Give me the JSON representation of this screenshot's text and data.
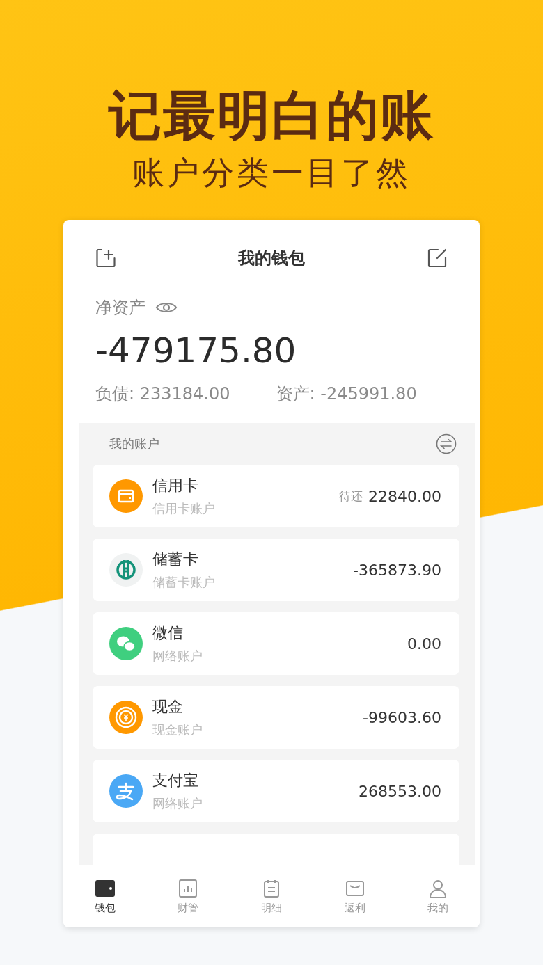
{
  "headline": "记最明白的账",
  "subheadline": "账户分类一目了然",
  "wallet": {
    "title": "我的钱包",
    "net_label": "净资产",
    "net_value": "-479175.80",
    "liabilities": "负债: 233184.00",
    "assets": "资产: -245991.80"
  },
  "accounts_header": "我的账户",
  "accounts": [
    {
      "kind": "card",
      "color": "#ff9800",
      "name": "信用卡",
      "type": "信用卡账户",
      "pending_label": "待还",
      "amount": "22840.00"
    },
    {
      "kind": "bank",
      "color": "#f0f2f2",
      "name": "储蓄卡",
      "type": "储蓄卡账户",
      "amount": "-365873.90"
    },
    {
      "kind": "wechat",
      "color": "#3fcf7f",
      "name": "微信",
      "type": "网络账户",
      "amount": "0.00"
    },
    {
      "kind": "cash",
      "color": "#ff9800",
      "name": "现金",
      "type": "现金账户",
      "amount": "-99603.60"
    },
    {
      "kind": "alipay",
      "color": "#4aa8f5",
      "name": "支付宝",
      "type": "网络账户",
      "amount": "268553.00"
    }
  ],
  "tabs": [
    {
      "kind": "wallet",
      "label": "钱包",
      "selected": true
    },
    {
      "kind": "finance",
      "label": "财管",
      "selected": false
    },
    {
      "kind": "detail",
      "label": "明细",
      "selected": false
    },
    {
      "kind": "rebate",
      "label": "返利",
      "selected": false
    },
    {
      "kind": "me",
      "label": "我的",
      "selected": false
    }
  ]
}
